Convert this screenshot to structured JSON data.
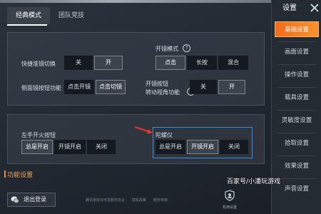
{
  "tabs": [
    {
      "label": "经典模式",
      "active": true
    },
    {
      "label": "团队竞技",
      "active": false
    }
  ],
  "settings": {
    "quick_scope": {
      "label": "快捷准镜切换",
      "options": [
        "关",
        "开"
      ],
      "selected": "开"
    },
    "side_scope": {
      "label": "侧面镜按钮功能",
      "options": [
        "点击开镜",
        "点击切镜"
      ],
      "selected": "点击切镜"
    },
    "scope_mode": {
      "label": "开镜模式",
      "help": "?",
      "options": [
        "点击",
        "长按",
        "混合"
      ],
      "selected": "点击"
    },
    "scope_turn": {
      "label_line1": "开镜按钮",
      "label_line2": "转动视角功能",
      "help": "?",
      "options": [
        "关",
        "开"
      ],
      "selected": "开"
    },
    "left_fire": {
      "label": "左手开火按钮",
      "options": [
        "总是开启",
        "开镜开启",
        "关闭"
      ],
      "selected": "总是开启"
    },
    "gyro": {
      "label": "陀螺仪",
      "options": [
        "总是开启",
        "开镜开启",
        "关闭"
      ],
      "selected": "开镜开启"
    }
  },
  "section": {
    "title": "功能设置"
  },
  "logout": {
    "label": "退出登录"
  },
  "footer_links": [
    "腾讯游戏许可及服务协议",
    "隐私政策",
    "服务条款"
  ],
  "shield": {
    "label": "机用设置"
  },
  "sidebar": {
    "title": "设置",
    "items": [
      {
        "label": "基础设置",
        "active": true
      },
      {
        "label": "画面设置",
        "active": false
      },
      {
        "label": "操作设置",
        "active": false
      },
      {
        "label": "载具设置",
        "active": false
      },
      {
        "label": "灵敏度设置",
        "active": false
      },
      {
        "label": "拾取设置",
        "active": false
      },
      {
        "label": "效果设置",
        "active": false
      },
      {
        "label": "声音设置",
        "active": false
      }
    ]
  },
  "watermark": "百家号/小潘玩游戏",
  "colors": {
    "accent": "#f36b1c",
    "highlight": "#2f8fe0",
    "arrow": "#e23a2a"
  }
}
